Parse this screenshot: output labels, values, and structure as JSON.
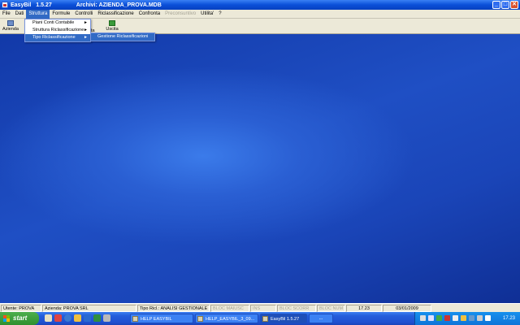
{
  "titlebar": {
    "app_name": "EasyBil",
    "version": "1.5.27",
    "archive": "Archivi: AZIENDA_PROVA.MDB",
    "min": "_",
    "max": "□",
    "close": "✕"
  },
  "menubar": {
    "items": [
      "File",
      "Dati",
      "Struttura",
      "Formule",
      "Controlli",
      "Riclassificazione",
      "Confronta",
      "Preconsuntivo",
      "Utilita'",
      "?"
    ],
    "active": "Struttura",
    "disabled": "Preconsuntivo"
  },
  "toolbar": {
    "azienda_label": "Azienda",
    "uscita_label": "Uscita",
    "partial_label": "ta"
  },
  "menu_struttura": {
    "items": [
      {
        "label": "Piani Conti Contabile",
        "has_submenu": true
      },
      {
        "label": "Struttura Riclassificazione",
        "has_submenu": true
      },
      {
        "label": "Tipo Riclassificazione",
        "has_submenu": true
      }
    ],
    "highlighted": "Tipo Riclassificazione",
    "submenu_arrow": "►"
  },
  "submenu_tipo": {
    "items": [
      "Gestione Riclassificazioni"
    ],
    "highlighted": "Gestione Riclassificazioni"
  },
  "statusbar": {
    "utente": "Utente: PROVA",
    "azienda": "Azienda: PROVA SRL",
    "tipo_ricl": "Tipo Ricl.: ANALISI GESTIONALE",
    "bloc_maiusc": "BLOC MAIUSC",
    "ins": "INS",
    "bloc_scorr": "BLOC SCORR",
    "bloc_num": "BLOC NUM",
    "time": "17.23",
    "date": "03/01/2009"
  },
  "taskbar": {
    "start_label": "start",
    "tasks": [
      "HELP EASYBIL",
      "HELP_EASYBIL_3_09...",
      "EasyBil    1.5.27"
    ],
    "more": "...",
    "clock": "17.23"
  },
  "colors": {
    "menu_highlight": "#316ac5",
    "titlebar": "#0a4fd8",
    "desktop": "#1b44b8",
    "taskbar": "#245edb",
    "start": "#2f8f2f"
  }
}
